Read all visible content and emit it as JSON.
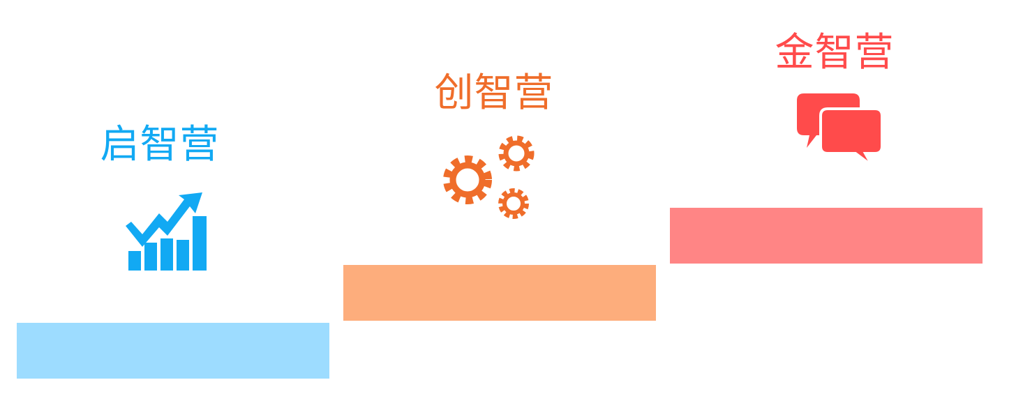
{
  "stages": [
    {
      "title": "启智营",
      "icon": "growth-chart-icon",
      "title_color": "#12a9f3",
      "step_color": "#9ddcff"
    },
    {
      "title": "创智营",
      "icon": "gears-icon",
      "title_color": "#ef6d2a",
      "step_color": "#fdad7c"
    },
    {
      "title": "金智营",
      "icon": "chat-bubbles-icon",
      "title_color": "#ff4b4b",
      "step_color": "#ff8585"
    }
  ]
}
